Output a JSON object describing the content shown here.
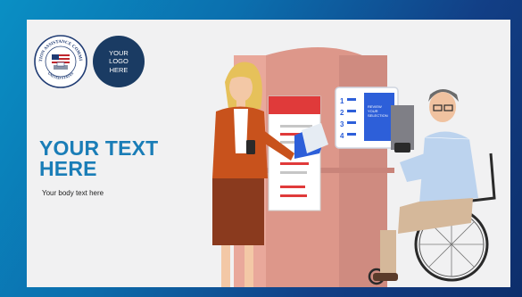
{
  "slide": {
    "headline_line1": "YOUR TEXT",
    "headline_line2": "HERE",
    "body": "Your body text here"
  },
  "logo": {
    "line1": "YOUR",
    "line2": "LOGO",
    "line3": "HERE"
  },
  "seal": {
    "arc_text": "ELECTION ASSISTANCE COMMISSION",
    "bottom_text": "UNITED STATES"
  },
  "kiosk": {
    "choices": [
      "1",
      "2",
      "3",
      "4"
    ],
    "screen_line1": "REVIEW",
    "screen_line2": "YOUR",
    "screen_line3": "SELECTION"
  },
  "colors": {
    "frame_start": "#0a8fc4",
    "frame_end": "#0d2e6b",
    "headline": "#1a7db7",
    "logo_circle": "#1a3b63"
  },
  "icons": [
    "eac-seal-icon",
    "ballot-icon",
    "wheelchair-icon",
    "phone-icon"
  ]
}
